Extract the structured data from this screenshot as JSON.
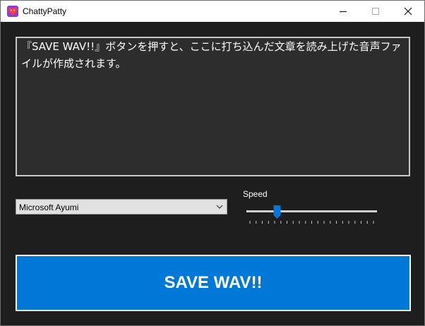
{
  "window": {
    "title": "ChattyPatty",
    "icon": "heart-app-icon",
    "controls": {
      "minimize_icon": "minimize-icon",
      "maximize_icon": "maximize-icon",
      "close_icon": "close-icon"
    }
  },
  "editor": {
    "text": "『SAVE WAV!!』ボタンを押すと、ここに打ち込んだ文章を読み上げた音声ファイルが作成されます。"
  },
  "voice_select": {
    "selected": "Microsoft Ayumi",
    "icon": "chevron-down-icon"
  },
  "speed": {
    "label": "Speed",
    "value_fraction": 0.22,
    "tick_count": 21
  },
  "save_button": {
    "label": "SAVE WAV!!"
  },
  "colors": {
    "background": "#1e1e1e",
    "editor_background": "#2d2d2d",
    "accent": "#0078d7",
    "app_icon": "#8a3fd1"
  }
}
